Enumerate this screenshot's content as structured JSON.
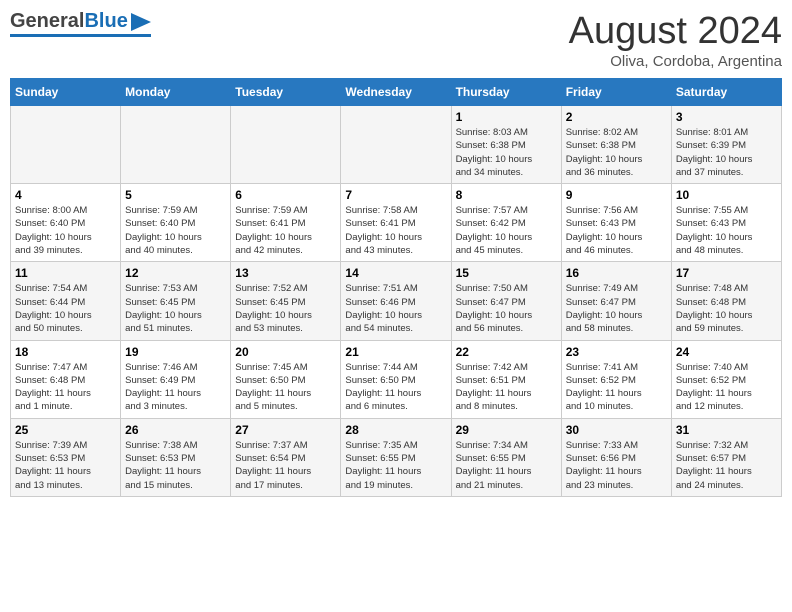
{
  "header": {
    "logo_general": "General",
    "logo_blue": "Blue",
    "month_year": "August 2024",
    "location": "Oliva, Cordoba, Argentina"
  },
  "days_of_week": [
    "Sunday",
    "Monday",
    "Tuesday",
    "Wednesday",
    "Thursday",
    "Friday",
    "Saturday"
  ],
  "weeks": [
    [
      {
        "num": "",
        "info": ""
      },
      {
        "num": "",
        "info": ""
      },
      {
        "num": "",
        "info": ""
      },
      {
        "num": "",
        "info": ""
      },
      {
        "num": "1",
        "info": "Sunrise: 8:03 AM\nSunset: 6:38 PM\nDaylight: 10 hours\nand 34 minutes."
      },
      {
        "num": "2",
        "info": "Sunrise: 8:02 AM\nSunset: 6:38 PM\nDaylight: 10 hours\nand 36 minutes."
      },
      {
        "num": "3",
        "info": "Sunrise: 8:01 AM\nSunset: 6:39 PM\nDaylight: 10 hours\nand 37 minutes."
      }
    ],
    [
      {
        "num": "4",
        "info": "Sunrise: 8:00 AM\nSunset: 6:40 PM\nDaylight: 10 hours\nand 39 minutes."
      },
      {
        "num": "5",
        "info": "Sunrise: 7:59 AM\nSunset: 6:40 PM\nDaylight: 10 hours\nand 40 minutes."
      },
      {
        "num": "6",
        "info": "Sunrise: 7:59 AM\nSunset: 6:41 PM\nDaylight: 10 hours\nand 42 minutes."
      },
      {
        "num": "7",
        "info": "Sunrise: 7:58 AM\nSunset: 6:41 PM\nDaylight: 10 hours\nand 43 minutes."
      },
      {
        "num": "8",
        "info": "Sunrise: 7:57 AM\nSunset: 6:42 PM\nDaylight: 10 hours\nand 45 minutes."
      },
      {
        "num": "9",
        "info": "Sunrise: 7:56 AM\nSunset: 6:43 PM\nDaylight: 10 hours\nand 46 minutes."
      },
      {
        "num": "10",
        "info": "Sunrise: 7:55 AM\nSunset: 6:43 PM\nDaylight: 10 hours\nand 48 minutes."
      }
    ],
    [
      {
        "num": "11",
        "info": "Sunrise: 7:54 AM\nSunset: 6:44 PM\nDaylight: 10 hours\nand 50 minutes."
      },
      {
        "num": "12",
        "info": "Sunrise: 7:53 AM\nSunset: 6:45 PM\nDaylight: 10 hours\nand 51 minutes."
      },
      {
        "num": "13",
        "info": "Sunrise: 7:52 AM\nSunset: 6:45 PM\nDaylight: 10 hours\nand 53 minutes."
      },
      {
        "num": "14",
        "info": "Sunrise: 7:51 AM\nSunset: 6:46 PM\nDaylight: 10 hours\nand 54 minutes."
      },
      {
        "num": "15",
        "info": "Sunrise: 7:50 AM\nSunset: 6:47 PM\nDaylight: 10 hours\nand 56 minutes."
      },
      {
        "num": "16",
        "info": "Sunrise: 7:49 AM\nSunset: 6:47 PM\nDaylight: 10 hours\nand 58 minutes."
      },
      {
        "num": "17",
        "info": "Sunrise: 7:48 AM\nSunset: 6:48 PM\nDaylight: 10 hours\nand 59 minutes."
      }
    ],
    [
      {
        "num": "18",
        "info": "Sunrise: 7:47 AM\nSunset: 6:48 PM\nDaylight: 11 hours\nand 1 minute."
      },
      {
        "num": "19",
        "info": "Sunrise: 7:46 AM\nSunset: 6:49 PM\nDaylight: 11 hours\nand 3 minutes."
      },
      {
        "num": "20",
        "info": "Sunrise: 7:45 AM\nSunset: 6:50 PM\nDaylight: 11 hours\nand 5 minutes."
      },
      {
        "num": "21",
        "info": "Sunrise: 7:44 AM\nSunset: 6:50 PM\nDaylight: 11 hours\nand 6 minutes."
      },
      {
        "num": "22",
        "info": "Sunrise: 7:42 AM\nSunset: 6:51 PM\nDaylight: 11 hours\nand 8 minutes."
      },
      {
        "num": "23",
        "info": "Sunrise: 7:41 AM\nSunset: 6:52 PM\nDaylight: 11 hours\nand 10 minutes."
      },
      {
        "num": "24",
        "info": "Sunrise: 7:40 AM\nSunset: 6:52 PM\nDaylight: 11 hours\nand 12 minutes."
      }
    ],
    [
      {
        "num": "25",
        "info": "Sunrise: 7:39 AM\nSunset: 6:53 PM\nDaylight: 11 hours\nand 13 minutes."
      },
      {
        "num": "26",
        "info": "Sunrise: 7:38 AM\nSunset: 6:53 PM\nDaylight: 11 hours\nand 15 minutes."
      },
      {
        "num": "27",
        "info": "Sunrise: 7:37 AM\nSunset: 6:54 PM\nDaylight: 11 hours\nand 17 minutes."
      },
      {
        "num": "28",
        "info": "Sunrise: 7:35 AM\nSunset: 6:55 PM\nDaylight: 11 hours\nand 19 minutes."
      },
      {
        "num": "29",
        "info": "Sunrise: 7:34 AM\nSunset: 6:55 PM\nDaylight: 11 hours\nand 21 minutes."
      },
      {
        "num": "30",
        "info": "Sunrise: 7:33 AM\nSunset: 6:56 PM\nDaylight: 11 hours\nand 23 minutes."
      },
      {
        "num": "31",
        "info": "Sunrise: 7:32 AM\nSunset: 6:57 PM\nDaylight: 11 hours\nand 24 minutes."
      }
    ]
  ]
}
